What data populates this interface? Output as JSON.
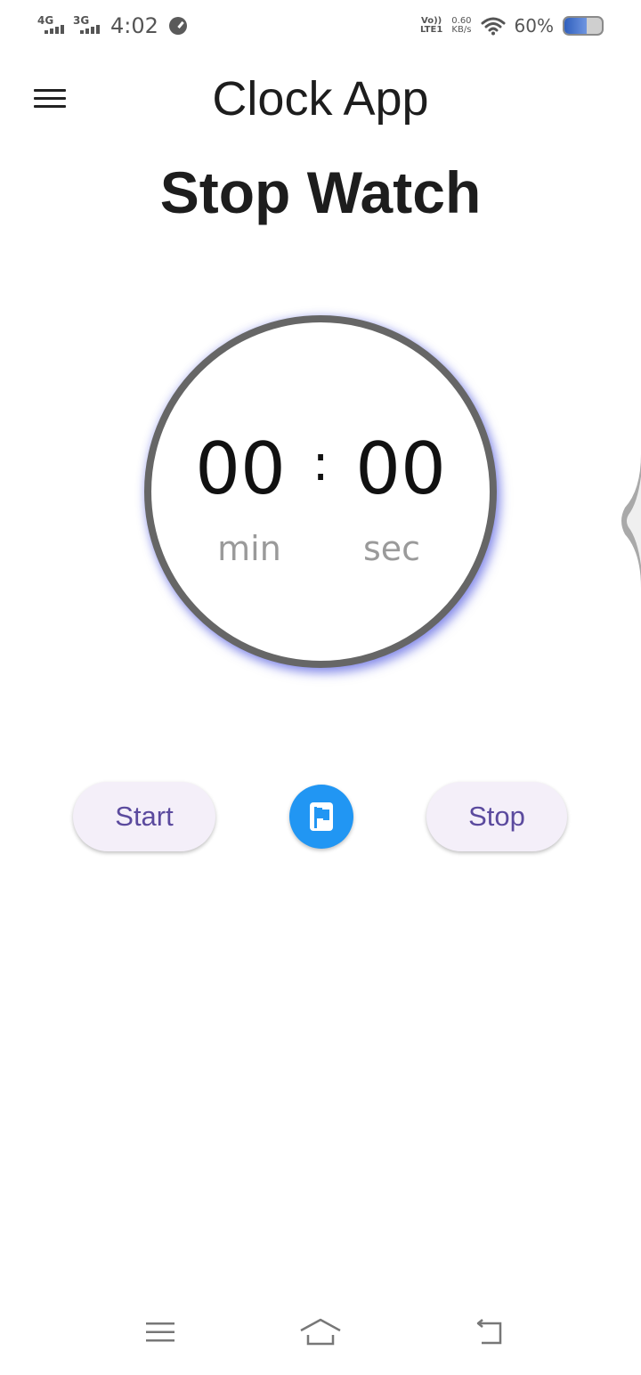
{
  "status_bar": {
    "network1": "4G",
    "network2": "3G",
    "time": "4:02",
    "volte_top": "Vo))",
    "volte_bottom": "LTE1",
    "net_speed_value": "0.60",
    "net_speed_unit": "KB/s",
    "battery_percent": "60%",
    "battery_level": 0.6
  },
  "app_bar": {
    "title": "Clock App"
  },
  "page": {
    "title": "Stop Watch"
  },
  "stopwatch": {
    "minutes": "00",
    "separator": ":",
    "seconds": "00",
    "minutes_unit": "min",
    "seconds_unit": "sec"
  },
  "controls": {
    "start_label": "Start",
    "stop_label": "Stop",
    "lap_icon": "flag-icon"
  },
  "colors": {
    "accent": "#2196f3",
    "button_text": "#5b4a9e",
    "button_bg": "#f4eff9",
    "dial_glow": "#3c46dc"
  }
}
